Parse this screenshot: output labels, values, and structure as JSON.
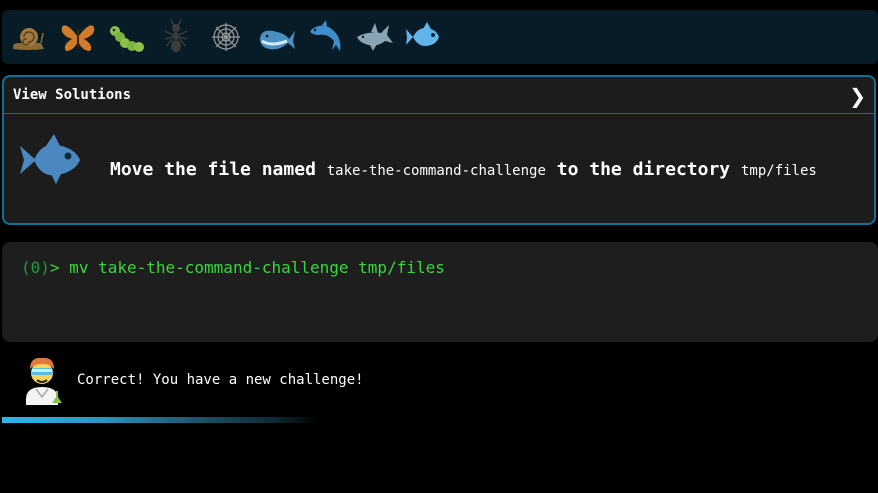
{
  "levels": {
    "items": [
      {
        "name": "snail-icon",
        "color": "#8b6a3a"
      },
      {
        "name": "butterfly-icon",
        "color": "#d07a2a"
      },
      {
        "name": "caterpillar-icon",
        "color": "#8bc34a"
      },
      {
        "name": "ant-icon",
        "color": "#3b3b3b"
      },
      {
        "name": "spider-web-icon",
        "color": "#9a9a9a"
      },
      {
        "name": "whale-icon",
        "color": "#4a90c2"
      },
      {
        "name": "dolphin-icon",
        "color": "#3f8ecb"
      },
      {
        "name": "shark-icon",
        "color": "#8aa4b4"
      },
      {
        "name": "fish-icon",
        "color": "#5fb4ea"
      }
    ],
    "active_index": 8
  },
  "panel": {
    "header": "View Solutions",
    "chevron": "❯",
    "challenge": {
      "icon": "fish-icon",
      "part1": "Move the file named ",
      "file": "take-the-command-challenge",
      "part2": " to the directory ",
      "dir": "tmp/files"
    }
  },
  "terminal": {
    "prompt_status": "(0)",
    "prompt_caret": ">",
    "command": " mv take-the-command-challenge tmp/files"
  },
  "feedback": {
    "avatar": "scientist-avatar",
    "message": "Correct! You have a new challenge!"
  },
  "progress": {
    "value": 0.6,
    "accent": "#2cb6ec"
  }
}
